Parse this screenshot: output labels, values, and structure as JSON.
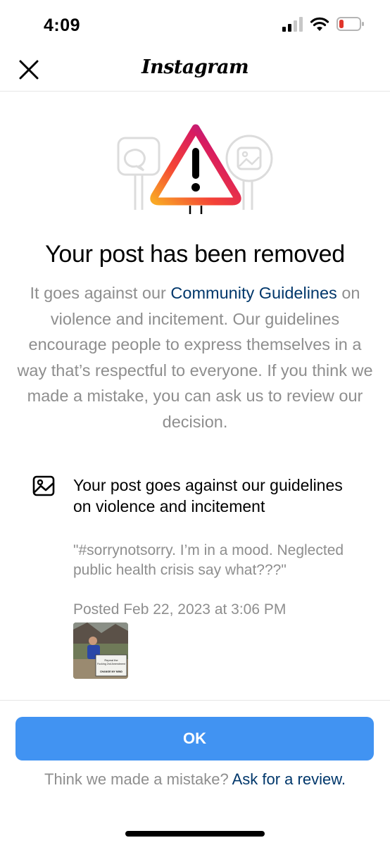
{
  "status_bar": {
    "time": "4:09",
    "icons": [
      "signal-icon",
      "wifi-icon",
      "battery-icon"
    ],
    "battery_color": "#e0352b"
  },
  "header": {
    "title": "Instagram",
    "close_icon": "close-icon"
  },
  "notice": {
    "illustration_icon": "warning-triangle-icon",
    "headline": "Your post has been removed",
    "description_before": "It goes against our ",
    "guidelines_link": "Community Guidelines",
    "description_after": " on violence and incitement. Our guidelines encourage people to express themselves in a way that’s respectful to everyone. If you think we made a mistake, you can ask us to review our decision."
  },
  "post": {
    "icon": "image-icon",
    "title": "Your post goes against our guidelines on violence and incitement",
    "caption": "\"#sorrynotsorry. I’m in a mood. Neglected public health crisis say what???\"",
    "posted": "Posted Feb 22, 2023 at 3:06 PM",
    "thumbnail_sign_text": [
      "Repeal the",
      "Fucking 2nd Amendment",
      "CHANGE MY MIND"
    ]
  },
  "footer": {
    "ok_label": "OK",
    "review_prompt": "Think we made a mistake? ",
    "review_link": "Ask for a review."
  },
  "colors": {
    "primary_button": "#4193f2",
    "link": "#00376b",
    "secondary_text": "#8e8e8e"
  }
}
